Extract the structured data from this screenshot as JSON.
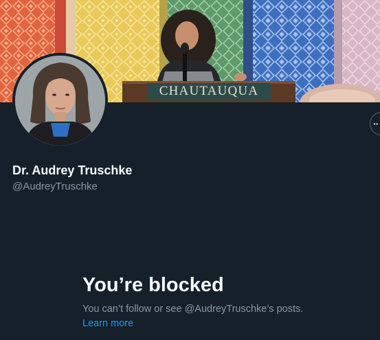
{
  "banner": {
    "podium_sign": "CHAUTAUQUA"
  },
  "profile": {
    "display_name": "Dr. Audrey Truschke",
    "username": "@AudreyTruschke",
    "more_label": "··"
  },
  "blocked": {
    "title": "You’re blocked",
    "description": "You can’t follow or see @AudreyTruschke’s posts.",
    "learn_more": "Learn more"
  },
  "colors": {
    "background": "#15202b",
    "text_primary": "#f7f9f9",
    "text_secondary": "#8b98a5",
    "link": "#1d9bf0"
  }
}
